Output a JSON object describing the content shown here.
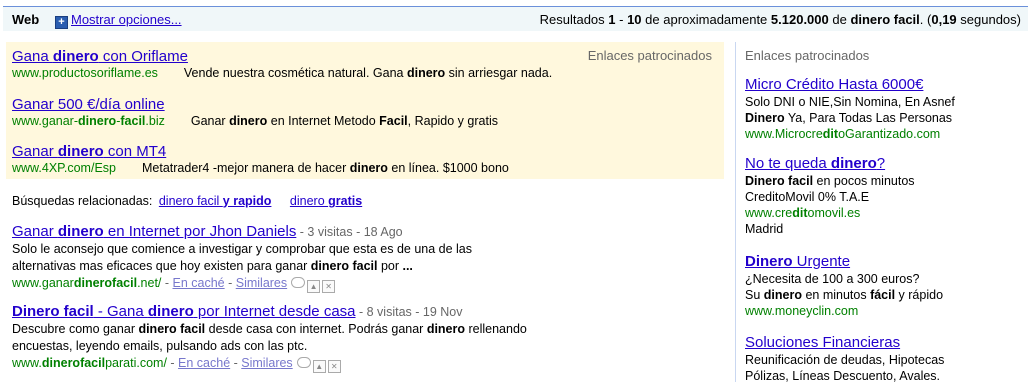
{
  "topbar": {
    "web_label": "Web",
    "options_link": "Mostrar opciones...",
    "stats_prefix": "Resultados ",
    "range_start": "1",
    "range_sep": " - ",
    "range_end": "10",
    "stats_mid": " de aproximadamente ",
    "total": "5.120.000",
    "stats_de": " de ",
    "query": "dinero facil",
    "stats_time_open": ". (",
    "time": "0,19",
    "stats_time_close": " segundos)"
  },
  "ads_top": {
    "label": "Enlaces patrocinados",
    "items": [
      {
        "title_a": "Gana ",
        "title_b": "dinero",
        "title_c": " con Oriflame",
        "url": "www.productosoriflame.es",
        "desc_a": "Vende nuestra cosmética natural. Gana ",
        "desc_b": "dinero",
        "desc_c": " sin arriesgar nada."
      },
      {
        "title_a": "Ganar 500 €/día online",
        "url_a": "www.ganar-",
        "url_b": "dinero",
        "url_c": "-",
        "url_d": "facil",
        "url_e": ".biz",
        "desc_a": "Ganar ",
        "desc_b": "dinero",
        "desc_c": " en Internet Metodo ",
        "desc_d": "Facil",
        "desc_e": ", Rapido y gratis"
      },
      {
        "title_a": "Ganar ",
        "title_b": "dinero",
        "title_c": " con MT4",
        "url": "www.4XP.com/Esp",
        "desc_a": "Metatrader4 -mejor manera de hacer ",
        "desc_b": "dinero",
        "desc_c": " en línea. $1000 bono"
      }
    ]
  },
  "related": {
    "label": "Búsquedas relacionadas:",
    "items": [
      {
        "a": "dinero facil ",
        "b": "y rapido"
      },
      {
        "a": "dinero ",
        "b": "gratis"
      }
    ]
  },
  "results": [
    {
      "title_a": "Ganar ",
      "title_b": "dinero",
      "title_c": " en Internet por Jhon Daniels",
      "meta": " - 3 visitas - 18 Ago",
      "snip1": "Solo le aconsejo que comience a investigar y comprobar que esta es de una de las",
      "snip2_a": "alternativas mas eficaces que hoy existen para ganar ",
      "snip2_b": "dinero facil",
      "snip2_c": " por ",
      "snip2_d": "...",
      "url_a": "www.ganar",
      "url_b": "dinerofacil",
      "url_c": ".net/",
      "cache": "En caché",
      "similar": "Similares"
    },
    {
      "title_a": "Dinero facil",
      "title_b": " - Gana ",
      "title_c": "dinero",
      "title_d": " por Internet desde casa",
      "meta": " - 8 visitas - 19 Nov",
      "snip1_a": "Descubre como ganar ",
      "snip1_b": "dinero facil",
      "snip1_c": " desde casa con internet. Podrás ganar ",
      "snip1_d": "dinero",
      "snip1_e": " rellenando",
      "snip2": "encuestas, leyendo emails, pulsando ads con las ptc.",
      "url_a": "www.",
      "url_b": "dinerofacil",
      "url_c": "parati.com/",
      "cache": "En caché",
      "similar": "Similares"
    }
  ],
  "rail": {
    "label": "Enlaces patrocinados",
    "ads": [
      {
        "title": "Micro Crédito Hasta 6000€",
        "l1": "Solo DNI o NIE,Sin Nomina, En Asnef",
        "l2_a": "Dinero",
        "l2_b": " Ya, Para Todas Las Personas",
        "url_a": "www.Microcre",
        "url_b": "dit",
        "url_c": "oGarantizado.com"
      },
      {
        "title_a": "No te queda ",
        "title_b": "dinero",
        "title_c": "?",
        "l1_a": "Dinero facil",
        "l1_b": " en pocos minutos",
        "l2": "CreditoMovil 0% T.A.E",
        "url_a": "www.cre",
        "url_b": "dit",
        "url_c": "omovil.es",
        "l3": "Madrid"
      },
      {
        "title_a": "Dinero",
        "title_b": " Urgente",
        "l1": "¿Necesita de 100 a 300 euros?",
        "l2_a": "Su ",
        "l2_b": "dinero",
        "l2_c": " en minutos ",
        "l2_d": "fácil",
        "l2_e": " y rápido",
        "url": "www.moneyclin.com"
      },
      {
        "title": "Soluciones Financieras",
        "l1": "Reunificación de deudas, Hipotecas",
        "l2": "Pólizas, Líneas Descuento, Avales."
      }
    ]
  }
}
